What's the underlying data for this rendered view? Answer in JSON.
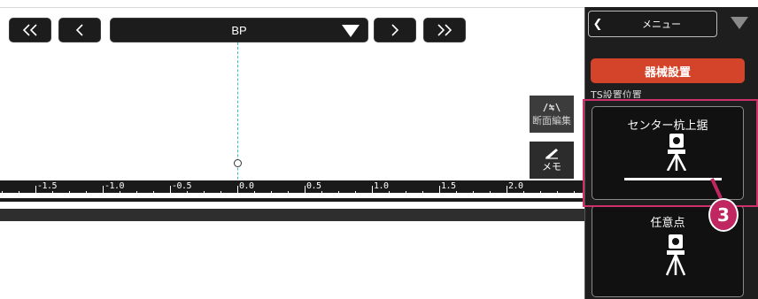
{
  "toolbar": {
    "first_label": "<<",
    "prev_label": "<",
    "station": "BP",
    "next_label": ">",
    "last_label": ">>"
  },
  "ruler": {
    "labels": [
      "-1.5",
      "-1.0",
      "-0.5",
      "0.0",
      "0.5",
      "1.0",
      "1.5",
      "2.0"
    ]
  },
  "tools": {
    "section_edit_label": "断面編集",
    "memo_label": "メモ"
  },
  "panel": {
    "menu_label": "メニュー",
    "primary_action": "器械設置",
    "section_label": "TS設置位置",
    "options": [
      {
        "title": "センター杭上据"
      },
      {
        "title": "任意点"
      }
    ],
    "callout_number": "3"
  },
  "colors": {
    "primary_action": "#d4442a",
    "highlight": "#d0306a",
    "centerline": "#2fc4c9"
  }
}
